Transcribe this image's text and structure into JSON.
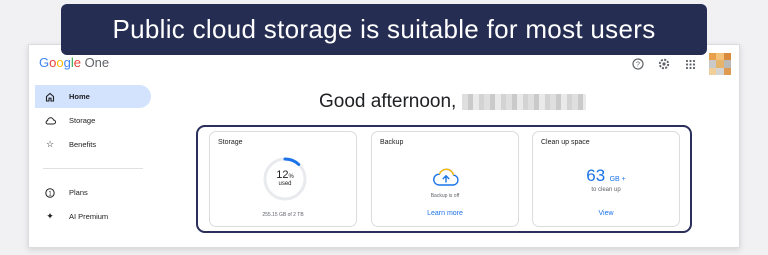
{
  "banner": {
    "text": "Public cloud storage is suitable for most users"
  },
  "app": {
    "logo_letters": [
      "G",
      "o",
      "o",
      "g",
      "l",
      "e"
    ],
    "logo_suffix": " One"
  },
  "header_icons": [
    "help-icon",
    "settings-icon",
    "apps-grid-icon",
    "avatar"
  ],
  "sidebar": {
    "items": [
      {
        "label": "Home",
        "icon": "home-icon",
        "active": true
      },
      {
        "label": "Storage",
        "icon": "cloud-icon"
      },
      {
        "label": "Benefits",
        "icon": "star-icon"
      },
      {
        "label": "Plans",
        "icon": "plans-icon"
      },
      {
        "label": "AI Premium",
        "icon": "sparkle-icon"
      }
    ]
  },
  "greeting": {
    "text": "Good afternoon,"
  },
  "cards": {
    "storage": {
      "title": "Storage",
      "percent": "12",
      "percent_symbol": "%",
      "used_label": "used",
      "progress_fraction": 0.12,
      "footer": "255.15 GB of 2 TB"
    },
    "backup": {
      "title": "Backup",
      "status": "Backup is off",
      "link": "Learn more"
    },
    "cleanup": {
      "title": "Clean up space",
      "value": "63",
      "unit": "GB +",
      "sub": "to clean up",
      "link": "View"
    }
  },
  "colors": {
    "banner_bg": "#252d52",
    "active_nav_bg": "#d3e3fd",
    "link_blue": "#1a73e8",
    "highlight_frame": "#2b2f5c"
  }
}
